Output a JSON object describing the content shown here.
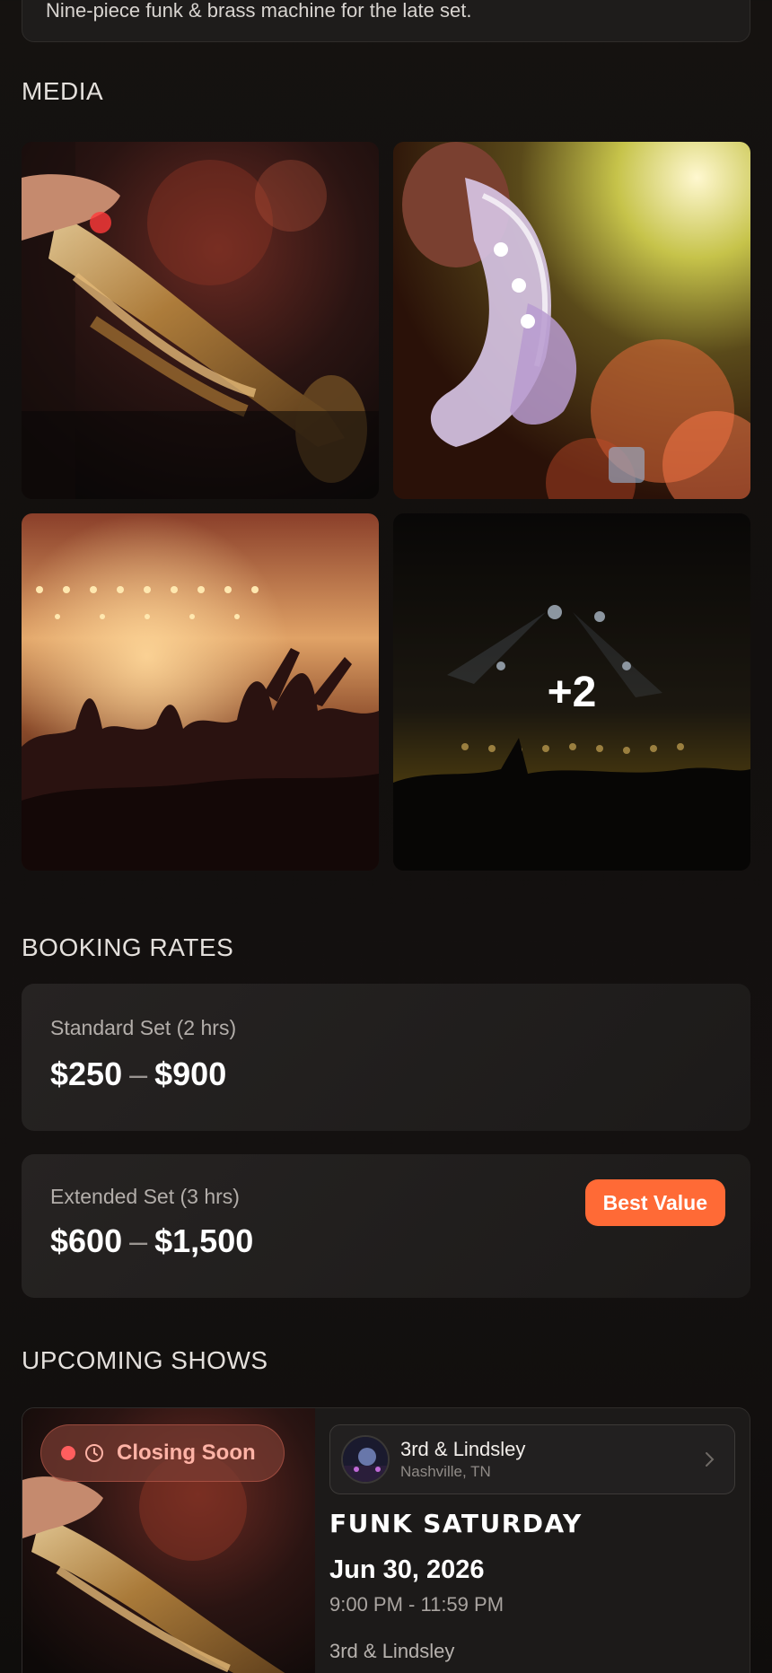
{
  "bio": {
    "text": "Nine-piece funk & brass machine for the late set."
  },
  "media": {
    "title": "MEDIA",
    "tiles": [
      {
        "name": "trumpet-photo",
        "icon": "photo"
      },
      {
        "name": "saxophone-photo",
        "icon": "photo"
      },
      {
        "name": "crowd-photo",
        "icon": "photo"
      },
      {
        "name": "stage-photo",
        "icon": "photo"
      }
    ],
    "more_count": "+2"
  },
  "booking": {
    "title": "BOOKING RATES",
    "rates": [
      {
        "name": "Standard Set (2 hrs)",
        "min": "$250",
        "max": "$900"
      },
      {
        "name": "Extended Set (3 hrs)",
        "min": "$600",
        "max": "$1,500",
        "badge": "Best Value"
      }
    ],
    "separator": "–"
  },
  "shows": {
    "title": "UPCOMING SHOWS",
    "items": [
      {
        "status": "Closing Soon",
        "venue_name": "3rd & Lindsley",
        "venue_location": "Nashville, TN",
        "title": "FUNK SATURDAY",
        "date": "Jun 30, 2026",
        "time": "9:00 PM - 11:59 PM",
        "venue": "3rd & Lindsley"
      }
    ]
  },
  "colors": {
    "accent": "#ff6a36",
    "closing": "#ff5e5e"
  }
}
